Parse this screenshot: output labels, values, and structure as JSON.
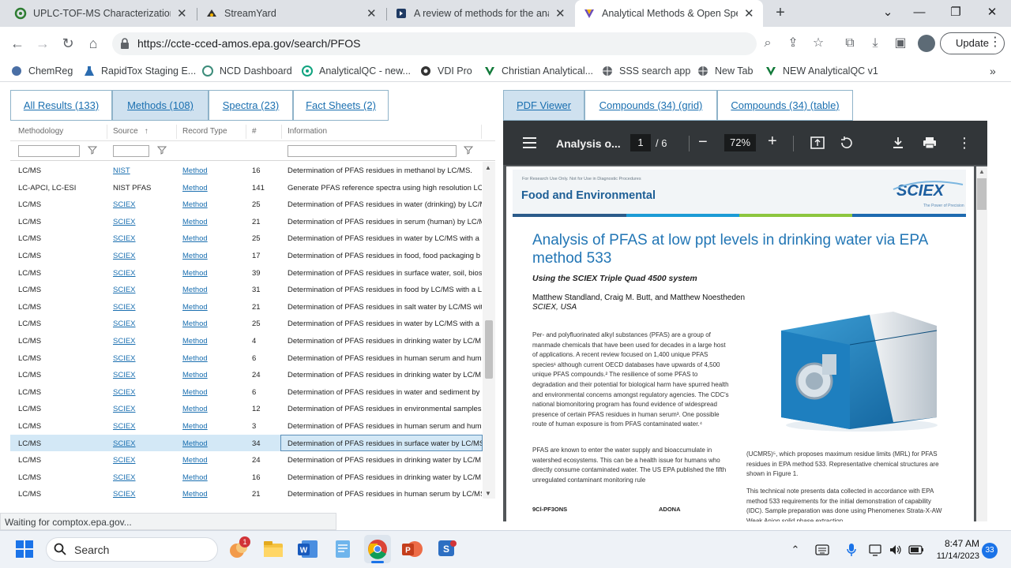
{
  "browser": {
    "tabs": [
      {
        "title": "UPLC-TOF-MS Characterization",
        "icon": "tox-icon"
      },
      {
        "title": "StreamYard",
        "icon": "streamyard-icon"
      },
      {
        "title": "A review of methods for the ana",
        "icon": "doc-icon"
      },
      {
        "title": "Analytical Methods & Open Spe",
        "icon": "v-icon"
      }
    ],
    "new_tab": "+",
    "url": "https://ccte-cced-amos.epa.gov/search/PFOS",
    "update_label": "Update",
    "bookmarks": [
      {
        "label": "ChemReg",
        "icon": "puzzle-icon"
      },
      {
        "label": "RapidTox Staging E...",
        "icon": "flask-icon"
      },
      {
        "label": "NCD Dashboard",
        "icon": "shield-icon"
      },
      {
        "label": "AnalyticalQC - new...",
        "icon": "chatgpt-icon"
      },
      {
        "label": "VDI Pro",
        "icon": "vdi-icon"
      },
      {
        "label": "Christian Analytical...",
        "icon": "v-icon"
      },
      {
        "label": "SSS search app",
        "icon": "globe-icon"
      },
      {
        "label": "New Tab",
        "icon": "globe-icon"
      },
      {
        "label": "NEW AnalyticalQC v1",
        "icon": "v-icon"
      }
    ],
    "bookmarks_more": "»",
    "status": "Waiting for comptox.epa.gov..."
  },
  "left": {
    "tabs": [
      "All Results (133)",
      "Methods (108)",
      "Spectra (23)",
      "Fact Sheets (2)"
    ],
    "selected_tab": 1,
    "columns": [
      "Methodology",
      "Source",
      "Record Type",
      "#",
      "Information"
    ],
    "sort_glyph": "↑",
    "rows": [
      {
        "methodology": "LC/MS",
        "source": "NIST",
        "link": true,
        "type": "Method",
        "num": "16",
        "info": "Determination of PFAS residues in methanol by LC/MS."
      },
      {
        "methodology": "LC-APCI, LC-ESI",
        "source": "NIST PFAS",
        "link": false,
        "type": "Method",
        "num": "141",
        "info": "Generate PFAS reference spectra using high resolution LC-"
      },
      {
        "methodology": "LC/MS",
        "source": "SCIEX",
        "link": true,
        "type": "Method",
        "num": "25",
        "info": "Determination of PFAS residues in water (drinking) by LC/M"
      },
      {
        "methodology": "LC/MS",
        "source": "SCIEX",
        "link": true,
        "type": "Method",
        "num": "21",
        "info": "Determination of PFAS residues in serum (human) by LC/M"
      },
      {
        "methodology": "LC/MS",
        "source": "SCIEX",
        "link": true,
        "type": "Method",
        "num": "25",
        "info": "Determination of PFAS residues in water by LC/MS with a l"
      },
      {
        "methodology": "LC/MS",
        "source": "SCIEX",
        "link": true,
        "type": "Method",
        "num": "17",
        "info": "Determination of PFAS residues in food, food packaging b"
      },
      {
        "methodology": "LC/MS",
        "source": "SCIEX",
        "link": true,
        "type": "Method",
        "num": "39",
        "info": "Determination of PFAS residues in surface water, soil, bios"
      },
      {
        "methodology": "LC/MS",
        "source": "SCIEX",
        "link": true,
        "type": "Method",
        "num": "31",
        "info": "Determination of PFAS residues in food by LC/MS with a L"
      },
      {
        "methodology": "LC/MS",
        "source": "SCIEX",
        "link": true,
        "type": "Method",
        "num": "21",
        "info": "Determination of PFAS residues in salt water by LC/MS wit"
      },
      {
        "methodology": "LC/MS",
        "source": "SCIEX",
        "link": true,
        "type": "Method",
        "num": "25",
        "info": "Determination of PFAS residues in water by LC/MS with a l"
      },
      {
        "methodology": "LC/MS",
        "source": "SCIEX",
        "link": true,
        "type": "Method",
        "num": "4",
        "info": "Determination of PFAS residues in drinking water by LC/M"
      },
      {
        "methodology": "LC/MS",
        "source": "SCIEX",
        "link": true,
        "type": "Method",
        "num": "6",
        "info": "Determination of PFAS residues in human serum and hum"
      },
      {
        "methodology": "LC/MS",
        "source": "SCIEX",
        "link": true,
        "type": "Method",
        "num": "24",
        "info": "Determination of PFAS residues in drinking water by LC/M"
      },
      {
        "methodology": "LC/MS",
        "source": "SCIEX",
        "link": true,
        "type": "Method",
        "num": "6",
        "info": "Determination of PFAS residues in water and sediment by"
      },
      {
        "methodology": "LC/MS",
        "source": "SCIEX",
        "link": true,
        "type": "Method",
        "num": "12",
        "info": "Determination of PFAS residues in environmental samples"
      },
      {
        "methodology": "LC/MS",
        "source": "SCIEX",
        "link": true,
        "type": "Method",
        "num": "3",
        "info": "Determination of PFAS residues in human serum and hum"
      },
      {
        "methodology": "LC/MS",
        "source": "SCIEX",
        "link": true,
        "type": "Method",
        "num": "34",
        "info": "Determination of PFAS residues in surface water by LC/MS"
      },
      {
        "methodology": "LC/MS",
        "source": "SCIEX",
        "link": true,
        "type": "Method",
        "num": "24",
        "info": "Determination of PFAS residues in drinking water by LC/M"
      },
      {
        "methodology": "LC/MS",
        "source": "SCIEX",
        "link": true,
        "type": "Method",
        "num": "16",
        "info": "Determination of PFAS residues in drinking water by LC/M"
      },
      {
        "methodology": "LC/MS",
        "source": "SCIEX",
        "link": true,
        "type": "Method",
        "num": "21",
        "info": "Determination of PFAS residues in human serum by LC/MS"
      }
    ],
    "selected_row": 16
  },
  "right": {
    "tabs": [
      "PDF Viewer",
      "Compounds (34) (grid)",
      "Compounds (34) (table)"
    ],
    "selected_tab": 0,
    "pdf": {
      "title": "Analysis o...",
      "page": "1",
      "pages": "/  6",
      "zoom": "72%",
      "minus": "−",
      "plus": "+"
    },
    "doc": {
      "disclaimer": "For Research Use Only. Not for Use in Diagnostic Procedures",
      "section": "Food and Environmental",
      "logo": "SCIEX",
      "logo_tag": "The Power of Precision",
      "heading": "Analysis of PFAS at low ppt levels in drinking water via EPA method 533",
      "subheading": "Using the SCIEX Triple Quad 4500 system",
      "authors": "Matthew Standland, Craig M. Butt, and Matthew Noestheden",
      "affiliation": "SCIEX, USA",
      "para1": "Per- and polyfluorinated alkyl substances (PFAS) are a group of manmade chemicals that have been used for decades in a large host of applications.  A recent review focused on 1,400 unique PFAS species¹ although current OECD databases have upwards of 4,500 unique PFAS compounds.² The resilience of some PFAS to degradation and their potential for biological harm have spurred health and environmental concerns amongst regulatory agencies.  The CDC's national biomonitoring program has found evidence of widespread presence of certain PFAS residues in human serum³.  One possible route of human exposure is from PFAS contaminated water.⁴",
      "para2": "PFAS are known to enter the water supply and bioaccumulate in watershed ecosystems.  This can be a health issue for humans who directly consume contaminated water.  The US EPA published the fifth unregulated contaminant monitoring rule",
      "para3": "(UCMR5)⁵, which proposes maximum residue limits (MRL) for PFAS residues in EPA method 533.  Representative chemical structures are shown in Figure 1.",
      "para4": "This technical note presents data collected in accordance with EPA method 533 requirements for the initial demonstration of capability (IDC). Sample preparation was done using Phenomenex Strata-X-AW Weak Anion solid phase extraction",
      "struct1": "9Cl-PF3ONS",
      "struct2": "ADONA"
    }
  },
  "taskbar": {
    "search": "Search",
    "time": "8:47 AM",
    "date": "11/14/2023",
    "badge": "33",
    "notif": "1"
  }
}
